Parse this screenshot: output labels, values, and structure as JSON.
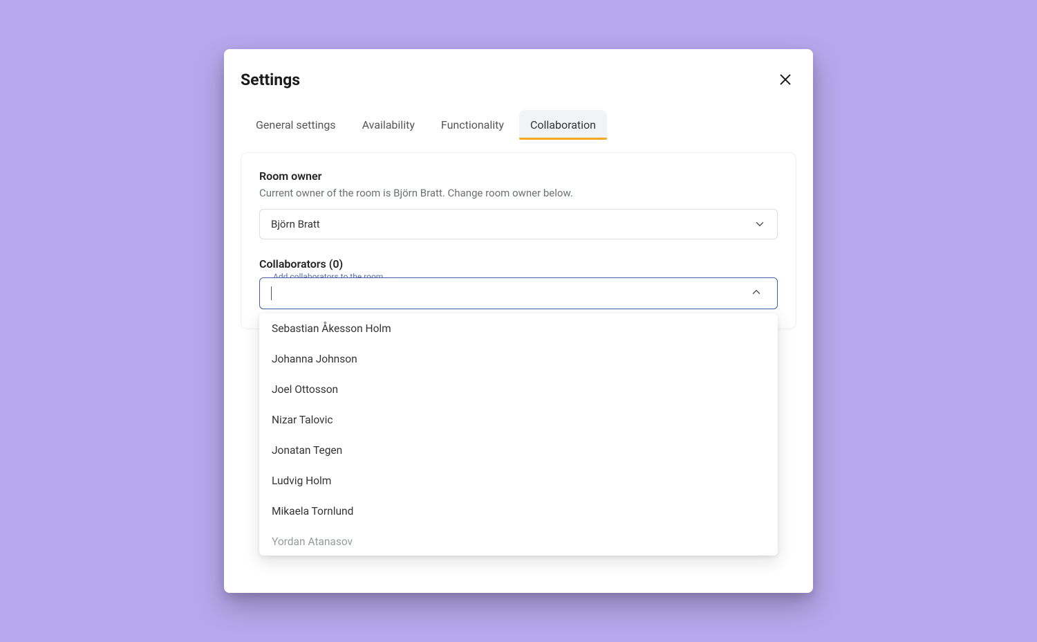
{
  "header": {
    "title": "Settings"
  },
  "tabs": {
    "items": [
      {
        "label": "General settings"
      },
      {
        "label": "Availability"
      },
      {
        "label": "Functionality"
      },
      {
        "label": "Collaboration"
      }
    ],
    "active_index": 3
  },
  "room_owner": {
    "heading": "Room owner",
    "description": "Current owner of the room is Björn Bratt. Change room owner below.",
    "selected": "Björn Bratt"
  },
  "collaborators": {
    "heading": "Collaborators (0)",
    "input_label": "Add collaborators to the room",
    "input_value": "",
    "options": [
      "Sebastian Åkesson Holm",
      "Johanna Johnson",
      "Joel Ottosson",
      "Nizar Talovic",
      "Jonatan Tegen",
      "Ludvig Holm",
      "Mikaela Tornlund",
      "Yordan Atanasov"
    ]
  }
}
